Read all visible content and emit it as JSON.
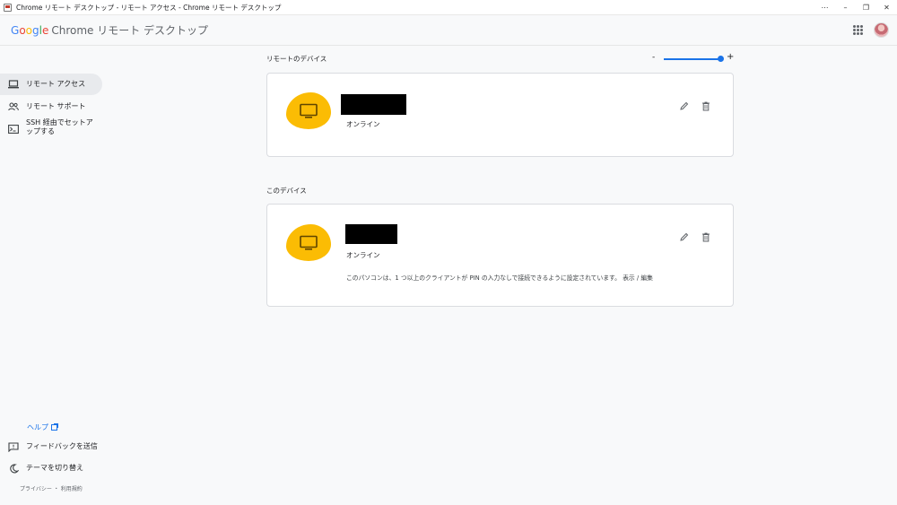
{
  "window": {
    "title": "Chrome リモート デスクトップ - リモート アクセス - Chrome リモート デスクトップ",
    "buttons": {
      "more": "⋯",
      "minimize": "–",
      "restore": "❐",
      "close": "✕"
    }
  },
  "header": {
    "logo_google": [
      "G",
      "o",
      "o",
      "g",
      "l",
      "e"
    ],
    "product": "Chrome リモート デスクトップ",
    "apps_icon": "apps-grid-icon",
    "avatar_icon": "account-avatar"
  },
  "sidebar": {
    "items": [
      {
        "label": "リモート アクセス",
        "icon": "laptop-icon",
        "active": true
      },
      {
        "label": "リモート サポート",
        "icon": "people-icon",
        "active": false
      },
      {
        "label": "SSH 経由でセットアップする",
        "label_line1": "SSH 経由でセットア",
        "label_line2": "ップする",
        "icon": "terminal-icon",
        "active": false
      }
    ],
    "help": "ヘルプ",
    "feedback": "フィードバックを送信",
    "theme": "テーマを切り替え",
    "footer": "プライバシー ・ 利用規約"
  },
  "main": {
    "remote_section": {
      "title": "リモートのデバイス",
      "zoom": {
        "minus": "-",
        "plus": "+",
        "level": 1.0
      },
      "devices": [
        {
          "status": "オンライン",
          "name_redacted": true
        }
      ]
    },
    "this_section": {
      "title": "このデバイス",
      "device": {
        "status": "オンライン",
        "name_redacted": true,
        "note": "このパソコンは、1 つ以上のクライアントが PIN の入力なしで接続できるように設定されています。",
        "note_link": "表示 / 編集"
      }
    },
    "colors": {
      "accent": "#1a73e8",
      "device_blob": "#fbbc04"
    }
  }
}
